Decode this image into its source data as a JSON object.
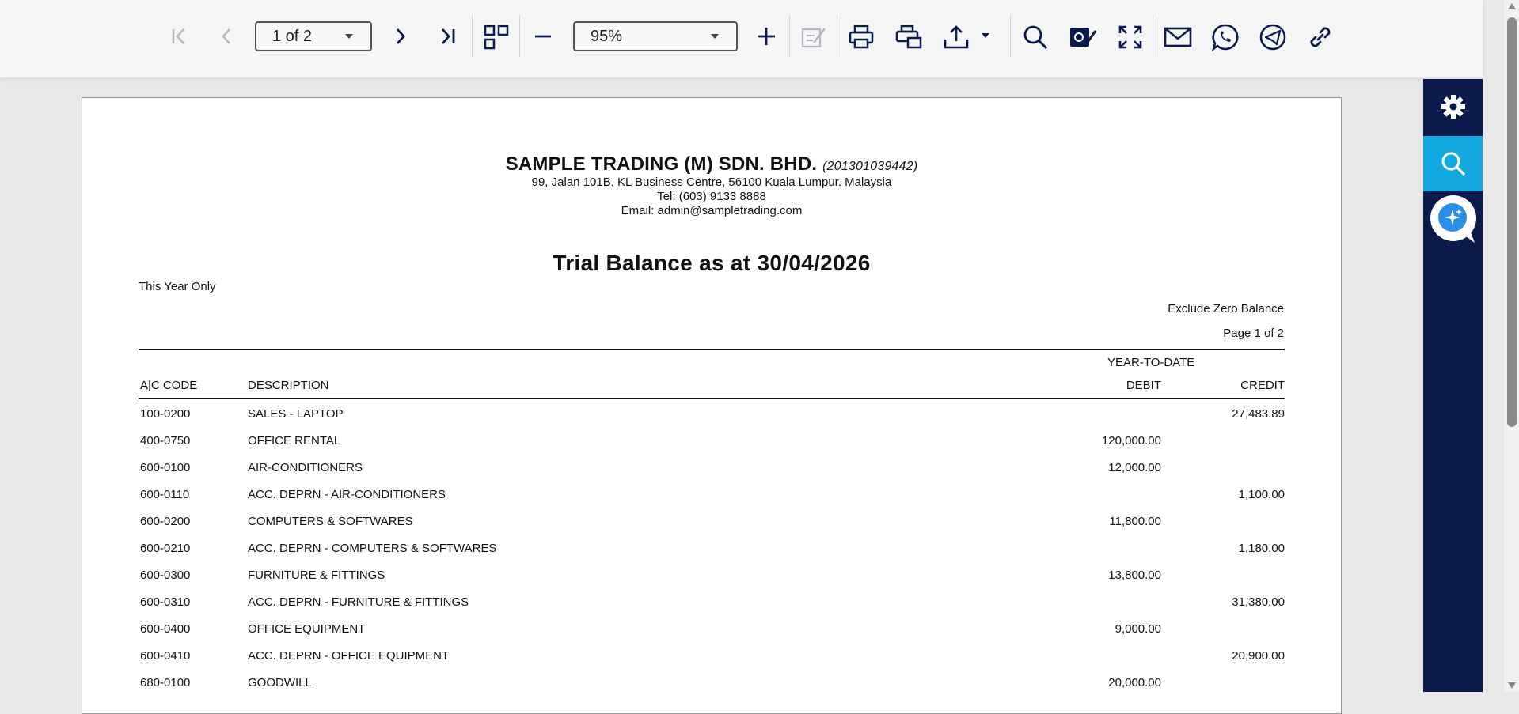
{
  "toolbar": {
    "page_select": "1 of 2",
    "zoom_select": "95%"
  },
  "report": {
    "company_name": "SAMPLE TRADING (M) SDN. BHD.",
    "company_reg": "(201301039442)",
    "address": "99, Jalan 101B, KL Business Centre, 56100 Kuala Lumpur. Malaysia",
    "tel": "Tel: (603) 9133 8888",
    "email": "Email: admin@sampletrading.com",
    "title": "Trial Balance as at 30/04/2026",
    "period": "This Year Only",
    "filter": "Exclude Zero Balance",
    "page_info": "Page 1 of 2",
    "headers": {
      "group": "YEAR-TO-DATE",
      "code": "A|C CODE",
      "description": "DESCRIPTION",
      "debit": "DEBIT",
      "credit": "CREDIT"
    },
    "rows": [
      {
        "code": "100-0200",
        "description": "SALES - LAPTOP",
        "debit": "",
        "credit": "27,483.89"
      },
      {
        "code": "400-0750",
        "description": "OFFICE RENTAL",
        "debit": "120,000.00",
        "credit": ""
      },
      {
        "code": "600-0100",
        "description": "AIR-CONDITIONERS",
        "debit": "12,000.00",
        "credit": ""
      },
      {
        "code": "600-0110",
        "description": "ACC. DEPRN - AIR-CONDITIONERS",
        "debit": "",
        "credit": "1,100.00"
      },
      {
        "code": "600-0200",
        "description": "COMPUTERS & SOFTWARES",
        "debit": "11,800.00",
        "credit": ""
      },
      {
        "code": "600-0210",
        "description": "ACC. DEPRN - COMPUTERS & SOFTWARES",
        "debit": "",
        "credit": "1,180.00"
      },
      {
        "code": "600-0300",
        "description": "FURNITURE & FITTINGS",
        "debit": "13,800.00",
        "credit": ""
      },
      {
        "code": "600-0310",
        "description": "ACC. DEPRN - FURNITURE & FITTINGS",
        "debit": "",
        "credit": "31,380.00"
      },
      {
        "code": "600-0400",
        "description": "OFFICE EQUIPMENT",
        "debit": "9,000.00",
        "credit": ""
      },
      {
        "code": "600-0410",
        "description": "ACC. DEPRN - OFFICE EQUIPMENT",
        "debit": "",
        "credit": "20,900.00"
      },
      {
        "code": "680-0100",
        "description": "GOODWILL",
        "debit": "20,000.00",
        "credit": ""
      }
    ]
  },
  "icons": {
    "first_page": "first-page-icon",
    "previous_page": "previous-page-icon",
    "next_page": "next-page-icon",
    "last_page": "last-page-icon",
    "thumbnails": "thumbnails-icon",
    "zoom_out": "zoom-out-icon",
    "zoom_in": "zoom-in-icon",
    "edit": "edit-form-icon",
    "print": "print-icon",
    "print_options": "print-setup-icon",
    "export": "export-icon",
    "search": "search-icon",
    "signature": "signature-icon",
    "fullscreen": "fullscreen-icon",
    "email": "email-icon",
    "whatsapp": "whatsapp-icon",
    "telegram": "telegram-icon",
    "link": "link-icon",
    "settings": "gear-icon",
    "sidebar_search": "search-icon",
    "assistant": "ai-assistant-icon"
  },
  "colors": {
    "toolbar_icon": "#0a1a4a",
    "sidebar": "#0a1a4a",
    "sidebar_active": "#12a8e0"
  }
}
